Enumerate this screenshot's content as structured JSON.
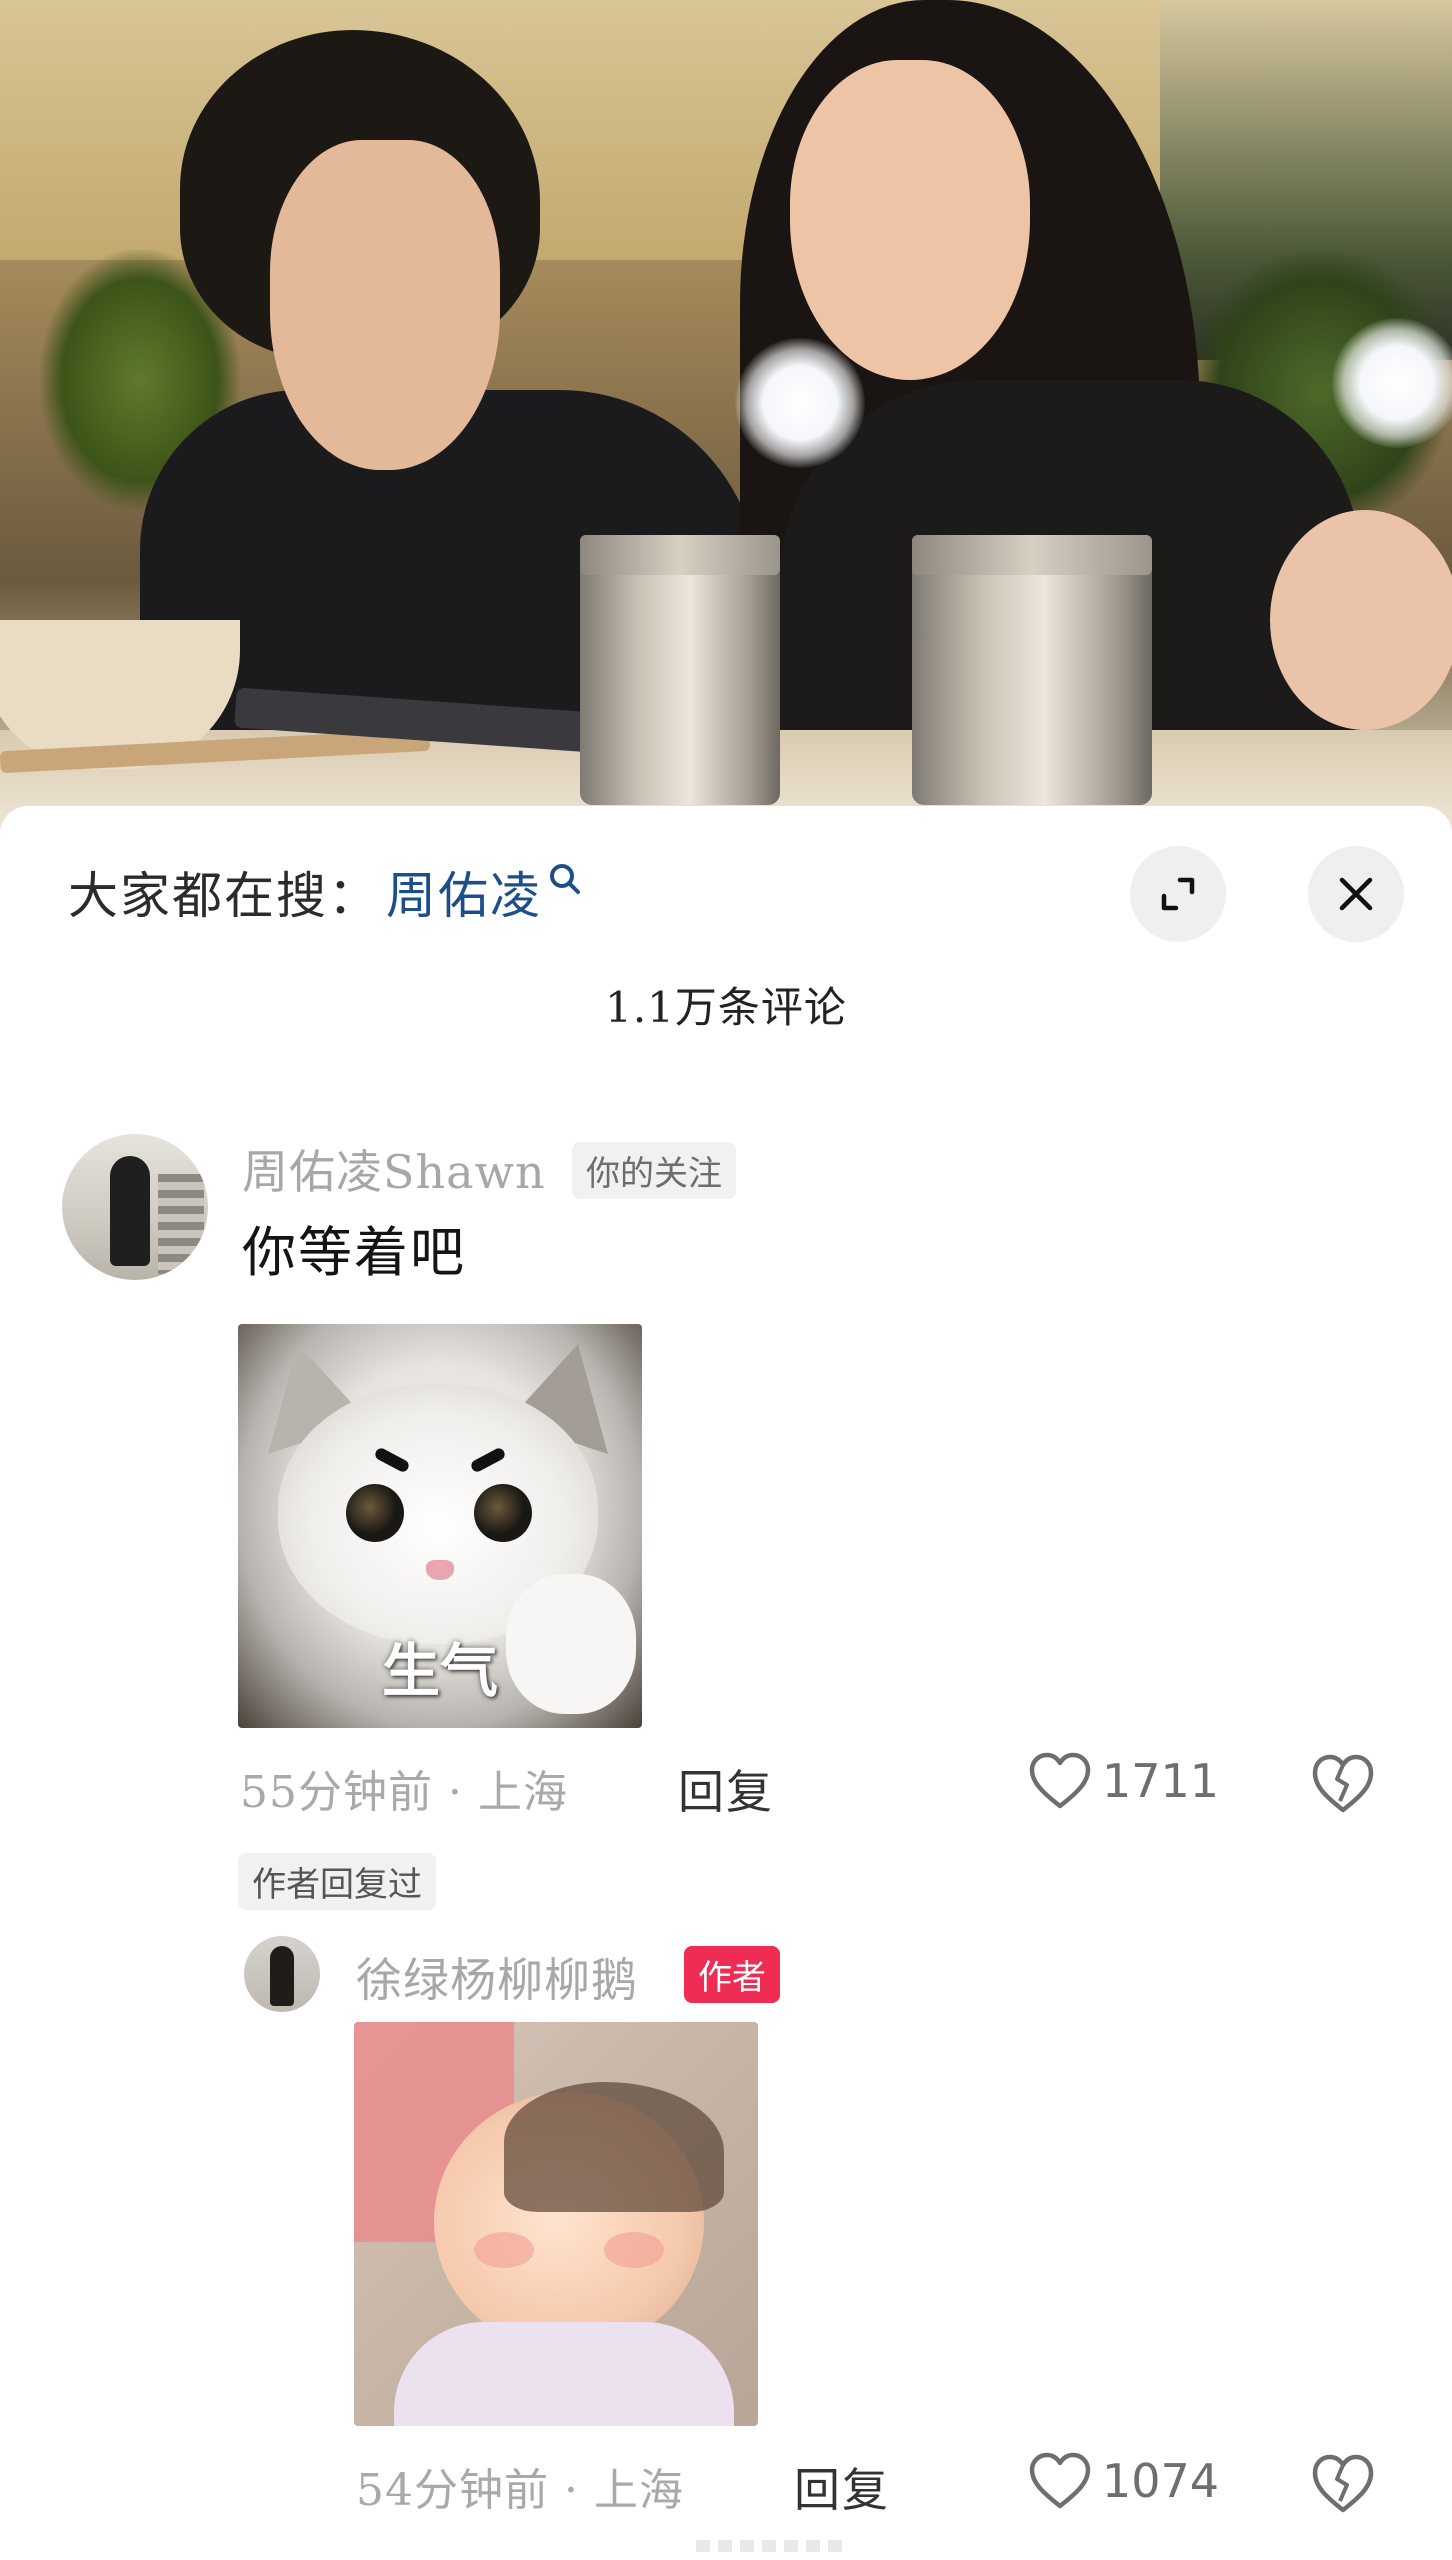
{
  "search": {
    "prefix": "大家都在搜：",
    "term": "周佑凌"
  },
  "header": {
    "comment_count": "1.1万条评论"
  },
  "comment": {
    "username": "周佑凌Shawn",
    "follow_tag": "你的关注",
    "text": "你等着吧",
    "sticker_caption": "生气",
    "meta": "55分钟前 · 上海",
    "reply_label": "回复",
    "likes": "1711",
    "author_replied_tag": "作者回复过"
  },
  "reply": {
    "username": "徐绿杨柳柳鹅",
    "author_tag": "作者",
    "meta": "54分钟前 · 上海",
    "reply_label": "回复",
    "likes": "1074"
  },
  "colors": {
    "search_term": "#1d4e8c",
    "author_tag_bg": "#ee2c54",
    "muted_text": "#a9a9a9"
  },
  "icons": [
    "search-icon",
    "expand-icon",
    "close-icon",
    "heart-icon",
    "broken-heart-icon"
  ]
}
